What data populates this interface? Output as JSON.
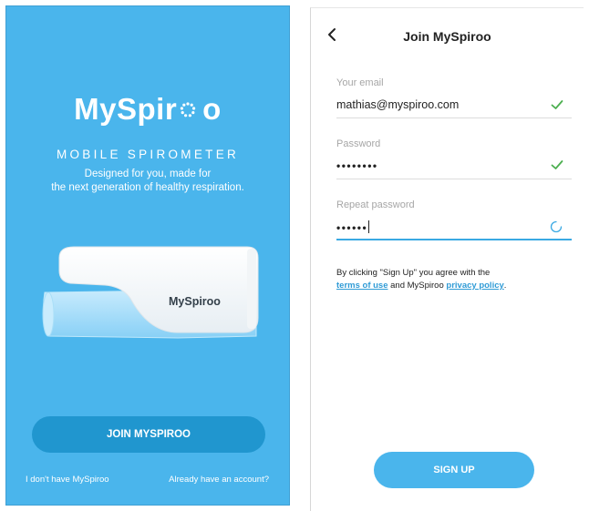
{
  "left": {
    "logo_text_prefix": "MySpir",
    "logo_text_suffix": "o",
    "subtitle": "MOBILE SPIROMETER",
    "tagline_line1": "Designed for you, made for",
    "tagline_line2": "the next generation of healthy respiration.",
    "device_brand": "MySpiroo",
    "join_button": "JOIN MYSPIROO",
    "link_no_device": "I don't have MySpiroo",
    "link_have_account": "Already have an account?",
    "background_color": "#4ab5ec",
    "button_color": "#2096cf"
  },
  "right": {
    "title": "Join MySpiroo",
    "back_icon": "chevron-left-icon",
    "email": {
      "label": "Your email",
      "value": "mathias@myspiroo.com",
      "status": "valid"
    },
    "password": {
      "label": "Password",
      "value": "••••••••",
      "status": "valid"
    },
    "repeat_password": {
      "label": "Repeat password",
      "value": "••••••",
      "status": "loading"
    },
    "terms": {
      "prefix": "By clicking \"Sign Up\" you agree with the",
      "terms_link": "terms of use",
      "middle": " and MySpiroo ",
      "privacy_link": "privacy policy",
      "suffix": "."
    },
    "signup_button": "SIGN UP",
    "accent_color": "#3aa9e3",
    "check_color": "#4caf50"
  }
}
